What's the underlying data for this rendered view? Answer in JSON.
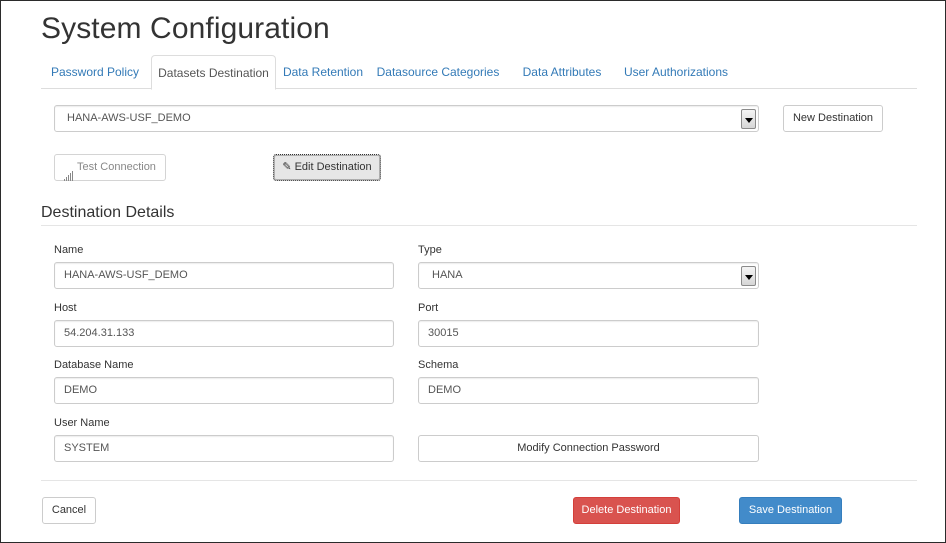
{
  "page": {
    "title": "System Configuration"
  },
  "tabs": [
    {
      "label": "Password Policy",
      "active": false
    },
    {
      "label": "Datasets Destination",
      "active": true
    },
    {
      "label": "Data Retention",
      "active": false
    },
    {
      "label": "Datasource Categories",
      "active": false
    },
    {
      "label": "Data Attributes",
      "active": false
    },
    {
      "label": "User Authorizations",
      "active": false
    }
  ],
  "destination_select": {
    "value": "HANA-AWS-USF_DEMO"
  },
  "toolbar": {
    "new_destination_label": "New Destination",
    "test_connection_label": "Test Connection",
    "test_connection_icon": "signal-bars-icon",
    "edit_destination_label": "Edit Destination",
    "edit_destination_icon": "edit-icon"
  },
  "details": {
    "title": "Destination Details",
    "name": {
      "label": "Name",
      "value": "HANA-AWS-USF_DEMO"
    },
    "type": {
      "label": "Type",
      "value": "HANA"
    },
    "host": {
      "label": "Host",
      "value": "54.204.31.133"
    },
    "port": {
      "label": "Port",
      "value": "30015"
    },
    "database_name": {
      "label": "Database Name",
      "value": "DEMO"
    },
    "schema": {
      "label": "Schema",
      "value": "DEMO"
    },
    "user_name": {
      "label": "User Name",
      "value": "SYSTEM"
    },
    "modify_password_label": "Modify Connection Password"
  },
  "footer": {
    "cancel_label": "Cancel",
    "delete_label": "Delete Destination",
    "save_label": "Save Destination"
  },
  "colors": {
    "link": "#337ab7",
    "danger": "#d9534f",
    "primary": "#428bca"
  }
}
